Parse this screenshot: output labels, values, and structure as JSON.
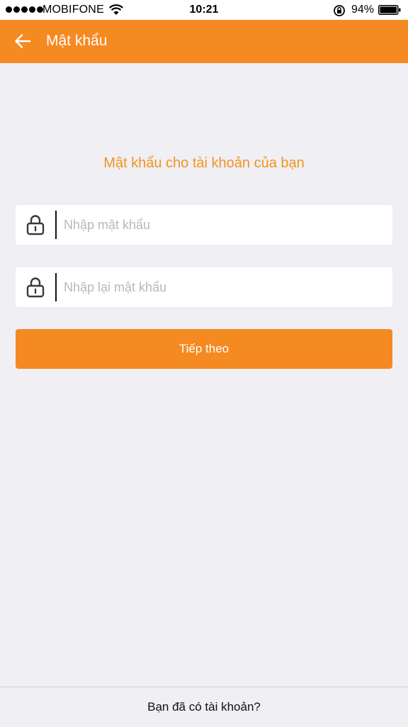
{
  "status_bar": {
    "carrier": "MOBIFONE",
    "time": "10:21",
    "battery": "94%",
    "signal_bars": 5,
    "icons": [
      "signal-dots-icon",
      "wifi-icon",
      "rotation-lock-icon",
      "battery-icon"
    ]
  },
  "nav": {
    "title": "Mật khẩu",
    "back_icon": "arrow-left-icon",
    "background": "#f58a22"
  },
  "main": {
    "headline": "Mật khẩu cho tài khoản của bạn",
    "password_field": {
      "placeholder": "Nhập mật khẩu",
      "value": "",
      "icon": "lock-icon"
    },
    "confirm_field": {
      "placeholder": "Nhập lại mật khẩu",
      "value": "",
      "icon": "lock-icon"
    },
    "next_button_label": "Tiếp theo"
  },
  "footer": {
    "login_link": "Bạn đã có tài khoản?"
  },
  "colors": {
    "accent": "#f58a22",
    "headline": "#f5921e",
    "background": "#efeff4"
  }
}
